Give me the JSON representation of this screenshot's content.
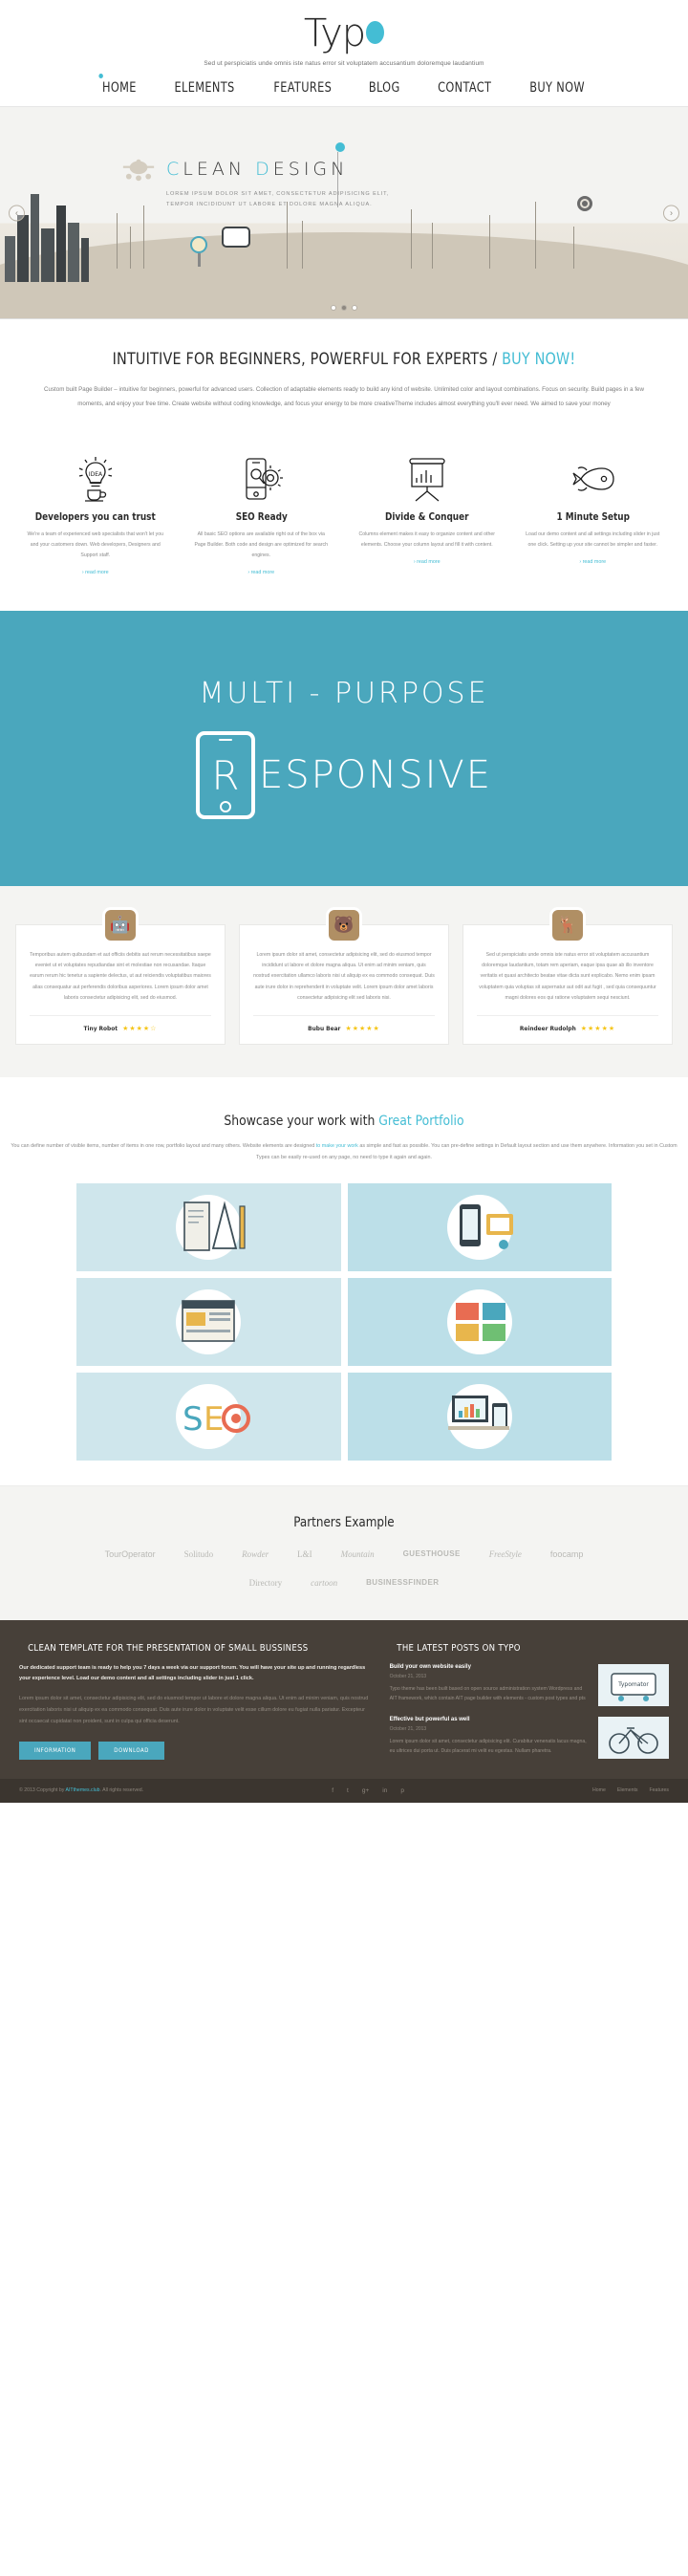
{
  "header": {
    "logo_text": "Typ",
    "logo_dot_color": "#44bdd4",
    "tagline": "Sed ut perspiciatis unde omnis iste natus error sit voluptatem accusantium doloremque laudantium",
    "nav": [
      {
        "label": "HOME",
        "active": true
      },
      {
        "label": "ELEMENTS",
        "active": false
      },
      {
        "label": "FEATURES",
        "active": false
      },
      {
        "label": "BLOG",
        "active": false
      },
      {
        "label": "CONTACT",
        "active": false
      },
      {
        "label": "BUY NOW",
        "active": false
      }
    ]
  },
  "hero": {
    "title_first": "C",
    "title_rest_1": "LEAN ",
    "title_d": "D",
    "title_rest_2": "ESIGN",
    "sub_line1": "LOREM IPSUM DOLOR SIT AMET, CONSECTETUR ADIPISICING ELIT,",
    "sub_line2": "TEMPOR INCIDIDUNT UT LABORE ET DOLORE MAGNA ALIQUA.",
    "prev_arrow": "‹",
    "next_arrow": "›",
    "dots": [
      "1",
      "2",
      "3"
    ],
    "active_dot": 1
  },
  "intro": {
    "title_main": "INTUITIVE FOR BEGINNERS, POWERFUL FOR EXPERTS / ",
    "title_highlight": "BUY NOW!",
    "paragraph": "Custom built Page Builder – intuitive for beginners, powerful for advanced users. Collection of adaptable elements ready to build any kind of website. Unlimited color and layout combinations. Focus on security. Build pages in a few moments, and enjoy your free time. Create website without coding knowledge, and focus your energy to be more creativeTheme includes almost everything you'll ever need. We aimed to save your money"
  },
  "features": [
    {
      "icon": "lightbulb-idea-icon",
      "title": "Developers you can trust",
      "text": "We're a team of experienced web specialists that won't let you and your customers down. Web developers, Designers and Support staff.",
      "link": "› read more"
    },
    {
      "icon": "mobile-gear-seo-icon",
      "title": "SEO Ready",
      "text": "All basic SEO options are available right out of the box via Page Builder. Both code and design are optimized for search engines.",
      "link": "› read more"
    },
    {
      "icon": "presentation-chart-icon",
      "title": "Divide & Conquer",
      "text": "Columns element makes it easy to organize content and other elements. Choose your column layout and fill it with content.",
      "link": "› read more"
    },
    {
      "icon": "rocket-icon",
      "title": "1 Minute Setup",
      "text": "Load our demo content and all settings including slider in just one click. Setting up your site cannot be simpler and faster.",
      "link": "› read more"
    }
  ],
  "banner": {
    "top_text": "MULTI - PURPOSE",
    "letter": "R",
    "word": "ESPONSIVE",
    "background": "#4aa7bd"
  },
  "testimonials": [
    {
      "avatar": "robot-avatar",
      "emoji": "🤖",
      "text": "Temporibus autem quibusdam et aut officiis debitis aut rerum necessitatibus saepe eveniet ut et voluptates repudiandae sint et molestiae non recusandae. Itaque earum rerum hic tenetur a sapiente delectus, ut aut reiciendis voluptatibus maiores alias consequatur aut perferendis doloribus asperiores. Lorem ipsum dolor amet laboris consectetur adipisicing elit, sed do eiusmod.",
      "name": "Tiny Robot",
      "stars": "★★★★☆"
    },
    {
      "avatar": "bear-avatar",
      "emoji": "🐻",
      "text": "Lorem ipsum dolor sit amet, consectetur adipisicing elit, sed do eiusmod tempor incididunt ut labore et dolore magna aliqua. Ut enim ad minim veniam, quis nostrud exercitation ullamco laboris nisi ut aliquip ex ea commodo consequat. Duis aute irure dolor in reprehenderit in voluptate velit. Lorem ipsum dolor amet laboris consectetur adipisicing elit sed laboris nisi.",
      "name": "Bubu Bear",
      "stars": "★★★★★"
    },
    {
      "avatar": "reindeer-avatar",
      "emoji": "🦌",
      "text": "Sed ut perspiciatis unde omnis iste natus error sit voluptatem accusantium doloremque laudantium, totam rem aperiam, eaque ipsa quae ab illo inventore veritatis et quasi architecto beatae vitae dicta sunt explicabo. Nemo enim ipsam voluptatem quia voluptas sit aspernatur aut odit aut fugit , sed quia consequuntur magni dolores eos qui ratione voluptatem sequi nesciunt.",
      "name": "Reindeer Rudolph",
      "stars": "★★★★★"
    }
  ],
  "portfolio": {
    "title_main": "Showcase your work with ",
    "title_highlight": "Great Portfolio",
    "text_before": "You can define number of visible items, number of items in one row, portfolio layout and many others. Website elements are designed ",
    "link_text": "to make your work",
    "text_after": " as simple and fast as possible. You can pre-define settings in Default layout section and use them anywhere. Information you set in Custom Types can be easily re-used on any page, no need to type it again and again.",
    "items": [
      {
        "name": "drafting-tools-thumb"
      },
      {
        "name": "mobile-devices-thumb"
      },
      {
        "name": "web-layout-thumb"
      },
      {
        "name": "ui-boxes-thumb"
      },
      {
        "name": "seo-letters-thumb"
      },
      {
        "name": "analytics-desk-thumb"
      }
    ]
  },
  "partners": {
    "title": "Partners Example",
    "logos": [
      {
        "label": "TourOperator",
        "style": "plain"
      },
      {
        "label": "Solitudo",
        "style": "serif"
      },
      {
        "label": "Rowder",
        "style": "script"
      },
      {
        "label": "L&I",
        "style": "serif"
      },
      {
        "label": "Mountain",
        "style": "script"
      },
      {
        "label": "GUESTHOUSE",
        "style": "bold"
      },
      {
        "label": "FreeStyle",
        "style": "script"
      },
      {
        "label": "foocamp",
        "style": "plain"
      },
      {
        "label": "Directory",
        "style": "serif"
      },
      {
        "label": "cartoon",
        "style": "script"
      },
      {
        "label": "BUSINESSFINDER",
        "style": "bold"
      }
    ]
  },
  "footer": {
    "left": {
      "title": "CLEAN TEMPLATE FOR THE PRESENTATION OF SMALL BUSSINESS",
      "lead": "Our dedicated support team is ready to help you 7 days a week via our support forum. You will have your site up and running regardless your experience level. Load our demo content and all settings including slider in just 1 click.",
      "body": "Lorem ipsum dolor sit amet, consectetur adipisicing elit, sed do eiusmod tempor ut labore et dolore magna aliqua. Ut enim ad minim veniam, quis nostrud exercitation laboris nisi ut aliquip ex ea commodo consequat. Duis aute irure dolor in voluptate velit esse cillum dolore eu fugiat nulla pariatur. Excepteur sint occaecat cupidatat non proident, sunt in culpa qui officia deserunt.",
      "buttons": [
        "INFORMATION",
        "DOWNLOAD"
      ]
    },
    "right": {
      "title": "THE LATEST POSTS ON TYPO",
      "posts": [
        {
          "title": "Build your own website easily",
          "date": "October 21, 2013",
          "excerpt": "Typo theme has been built based on open source administration system Wordpress and AIT framework, which contain AIT page builder with elements - custom post types and pts",
          "thumb": "typomator-thumb"
        },
        {
          "title": "Effective but powerful as well",
          "date": "October 21, 2013",
          "excerpt": "Lorem ipsum dolor sit amet, consectetur adipisicing elit. Curabitur venenatis lacus magna, eu ultrices dui porta ut. Duis placerat mi velit eu egestas. Nullam pharetra.",
          "thumb": "bicycle-thumb"
        }
      ]
    }
  },
  "copyright": {
    "text_before": "© 2013 Copyright by ",
    "link": "AITthemes.club",
    "text_after": ". All rights reserved.",
    "social": [
      "f",
      "t",
      "g+",
      "in",
      "p"
    ],
    "links": [
      "Home",
      "Elements",
      "Features"
    ]
  }
}
